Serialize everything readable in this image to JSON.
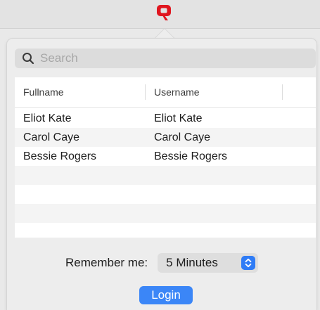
{
  "search": {
    "placeholder": "Search",
    "value": ""
  },
  "table": {
    "columns": [
      "Fullname",
      "Username"
    ],
    "rows": [
      {
        "fullname": "Eliot Kate",
        "username": "Eliot Kate"
      },
      {
        "fullname": "Carol Caye",
        "username": "Carol Caye"
      },
      {
        "fullname": "Bessie Rogers",
        "username": "Bessie Rogers"
      }
    ]
  },
  "remember": {
    "label": "Remember me:",
    "selected": "5 Minutes"
  },
  "login": {
    "label": "Login"
  },
  "colors": {
    "accent": "#3b86f7",
    "brand": "#e0161f"
  },
  "icons": {
    "app": "app-logo-icon",
    "search": "search-icon",
    "stepper": "chevron-up-down-icon"
  }
}
